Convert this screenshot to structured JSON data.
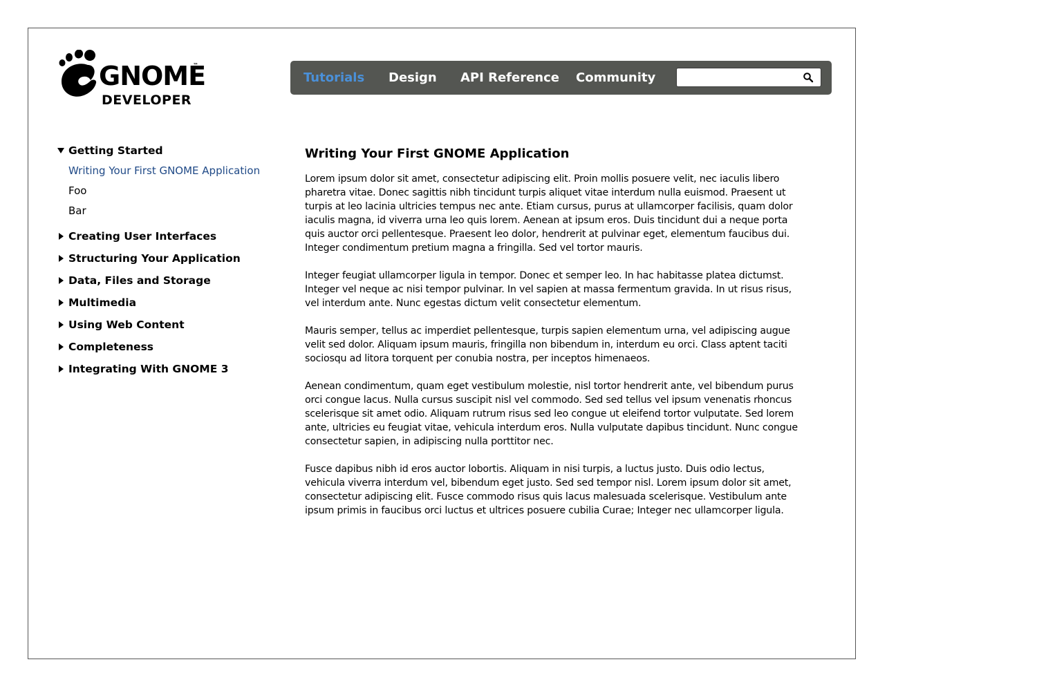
{
  "logo": {
    "name": "GNOME",
    "tm": "™",
    "subtitle": "DEVELOPER"
  },
  "nav": {
    "items": [
      {
        "label": "Tutorials",
        "active": true
      },
      {
        "label": "Design",
        "active": false
      },
      {
        "label": "API Reference",
        "active": false
      },
      {
        "label": "Community",
        "active": false
      }
    ],
    "search": {
      "value": "",
      "placeholder": ""
    },
    "colors": {
      "bar": "#545652",
      "active": "#4a90d9",
      "text": "#ffffff"
    }
  },
  "sidebar": {
    "sections": [
      {
        "label": "Getting Started",
        "expanded": true,
        "items": [
          {
            "label": "Writing Your First GNOME Application",
            "current": true
          },
          {
            "label": "Foo",
            "current": false
          },
          {
            "label": "Bar",
            "current": false
          }
        ]
      },
      {
        "label": "Creating User Interfaces",
        "expanded": false
      },
      {
        "label": "Structuring Your Application",
        "expanded": false
      },
      {
        "label": "Data, Files and Storage",
        "expanded": false
      },
      {
        "label": "Multimedia",
        "expanded": false
      },
      {
        "label": "Using Web Content",
        "expanded": false
      },
      {
        "label": "Completeness",
        "expanded": false
      },
      {
        "label": "Integrating With GNOME 3",
        "expanded": false
      }
    ],
    "colors": {
      "current": "#204a87"
    }
  },
  "main": {
    "title": "Writing Your First GNOME Application",
    "paragraphs": [
      "Lorem ipsum dolor sit amet, consectetur adipiscing elit. Proin mollis posuere velit, nec iaculis libero pharetra vitae. Donec sagittis nibh tincidunt turpis aliquet vitae interdum nulla euismod. Praesent ut turpis at leo lacinia ultricies tempus nec ante. Etiam cursus, purus at ullamcorper facilisis, quam dolor iaculis magna, id viverra urna leo quis lorem. Aenean at ipsum eros. Duis tincidunt dui a neque porta quis auctor orci pellentesque. Praesent leo dolor, hendrerit at pulvinar eget, elementum faucibus dui. Integer condimentum pretium magna a fringilla. Sed vel tortor mauris.",
      "Integer feugiat ullamcorper ligula in tempor. Donec et semper leo. In hac habitasse platea dictumst. Integer vel neque ac nisi tempor pulvinar. In vel sapien at massa fermentum gravida. In ut risus risus, vel interdum ante. Nunc egestas dictum velit consectetur elementum.",
      "Mauris semper, tellus ac imperdiet pellentesque, turpis sapien elementum urna, vel adipiscing augue velit sed dolor. Aliquam ipsum mauris, fringilla non bibendum in, interdum eu orci. Class aptent taciti sociosqu ad litora torquent per conubia nostra, per inceptos himenaeos.",
      "Aenean condimentum, quam eget vestibulum molestie, nisl tortor hendrerit ante, vel bibendum purus orci congue lacus. Nulla cursus suscipit nisl vel commodo. Sed sed tellus vel ipsum venenatis rhoncus scelerisque sit amet odio. Aliquam rutrum risus sed leo congue ut eleifend tortor vulputate. Sed lorem ante, ultricies eu feugiat vitae, vehicula interdum eros. Nulla vulputate dapibus tincidunt. Nunc congue consectetur sapien, in adipiscing nulla porttitor nec.",
      "Fusce dapibus nibh id eros auctor lobortis. Aliquam in nisi turpis, a luctus justo. Duis odio lectus, vehicula viverra interdum vel, bibendum eget justo. Sed sed tempor nisl. Lorem ipsum dolor sit amet, consectetur adipiscing elit. Fusce commodo risus quis lacus malesuada scelerisque. Vestibulum ante ipsum primis in faucibus orci luctus et ultrices posuere cubilia Curae; Integer nec ullamcorper ligula."
    ]
  }
}
